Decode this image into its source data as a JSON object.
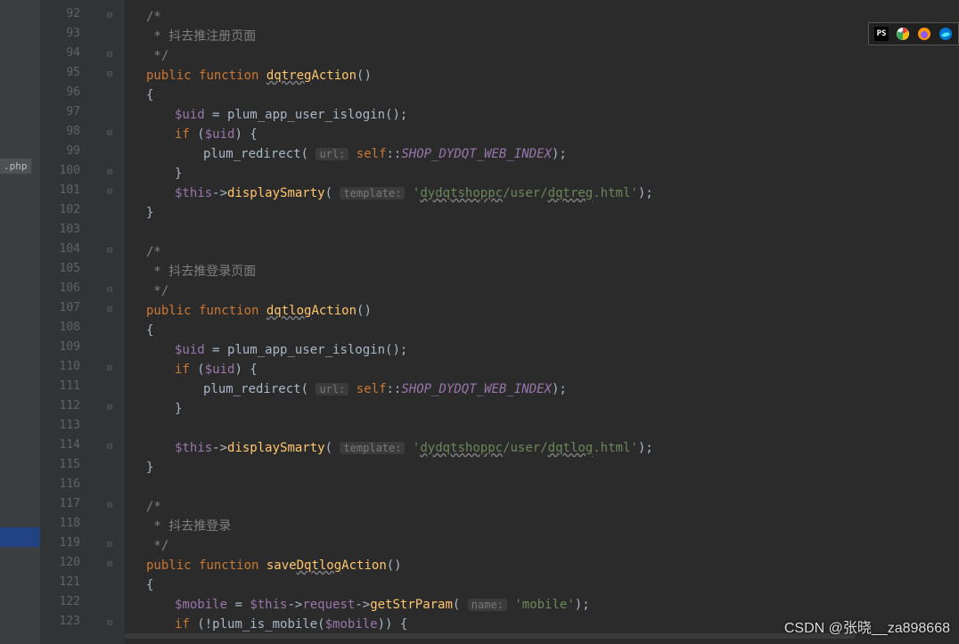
{
  "file": ".php",
  "watermark": "CSDN @张晓__za898668",
  "lines": [
    {
      "n": 92,
      "indent": 24,
      "tokens": [
        {
          "t": "/*",
          "c": "cmt"
        }
      ]
    },
    {
      "n": 93,
      "indent": 24,
      "tokens": [
        {
          "t": " * 抖去推注册页面",
          "c": "cmt"
        }
      ]
    },
    {
      "n": 94,
      "indent": 24,
      "tokens": [
        {
          "t": " */",
          "c": "cmt"
        }
      ]
    },
    {
      "n": 95,
      "indent": 24,
      "tokens": [
        {
          "t": "public ",
          "c": "kw"
        },
        {
          "t": "function ",
          "c": "kw"
        },
        {
          "t": "dqtreg",
          "c": "fn wavy"
        },
        {
          "t": "Action",
          "c": "fn"
        },
        {
          "t": "()",
          "c": "op"
        }
      ]
    },
    {
      "n": 96,
      "indent": 24,
      "tokens": [
        {
          "t": "{",
          "c": "op"
        }
      ]
    },
    {
      "n": 97,
      "indent": 56,
      "tokens": [
        {
          "t": "$uid",
          "c": "var"
        },
        {
          "t": " = ",
          "c": "op"
        },
        {
          "t": "plum_app_user_islogin",
          "c": "dot"
        },
        {
          "t": "();",
          "c": "op"
        }
      ]
    },
    {
      "n": 98,
      "indent": 56,
      "tokens": [
        {
          "t": "if ",
          "c": "kw"
        },
        {
          "t": "(",
          "c": "op"
        },
        {
          "t": "$uid",
          "c": "var"
        },
        {
          "t": ") {",
          "c": "op"
        }
      ]
    },
    {
      "n": 99,
      "indent": 88,
      "tokens": [
        {
          "t": "plum_redirect",
          "c": "dot"
        },
        {
          "t": "( ",
          "c": "op"
        },
        {
          "t": "url:",
          "c": "hint"
        },
        {
          "t": " ",
          "c": "op"
        },
        {
          "t": "self",
          "c": "kw"
        },
        {
          "t": "::",
          "c": "op"
        },
        {
          "t": "SHOP_DYDQT_WEB_INDEX",
          "c": "const"
        },
        {
          "t": ");",
          "c": "op"
        }
      ]
    },
    {
      "n": 100,
      "indent": 56,
      "tokens": [
        {
          "t": "}",
          "c": "op"
        }
      ]
    },
    {
      "n": 101,
      "indent": 56,
      "tokens": [
        {
          "t": "$this",
          "c": "var"
        },
        {
          "t": "->",
          "c": "op"
        },
        {
          "t": "displaySmarty",
          "c": "fn"
        },
        {
          "t": "( ",
          "c": "op"
        },
        {
          "t": "template:",
          "c": "hint"
        },
        {
          "t": " ",
          "c": "op"
        },
        {
          "t": "'",
          "c": "str"
        },
        {
          "t": "dydqtshoppc",
          "c": "str wavy"
        },
        {
          "t": "/user/",
          "c": "str"
        },
        {
          "t": "dqtreg",
          "c": "str wavy"
        },
        {
          "t": ".html'",
          "c": "str"
        },
        {
          "t": ");",
          "c": "op"
        }
      ]
    },
    {
      "n": 102,
      "indent": 24,
      "tokens": [
        {
          "t": "}",
          "c": "op"
        }
      ]
    },
    {
      "n": 103,
      "indent": 24,
      "tokens": []
    },
    {
      "n": 104,
      "indent": 24,
      "tokens": [
        {
          "t": "/*",
          "c": "cmt"
        }
      ]
    },
    {
      "n": 105,
      "indent": 24,
      "tokens": [
        {
          "t": " * 抖去推登录页面",
          "c": "cmt"
        }
      ]
    },
    {
      "n": 106,
      "indent": 24,
      "tokens": [
        {
          "t": " */",
          "c": "cmt"
        }
      ]
    },
    {
      "n": 107,
      "indent": 24,
      "tokens": [
        {
          "t": "public ",
          "c": "kw"
        },
        {
          "t": "function ",
          "c": "kw"
        },
        {
          "t": "dqtlog",
          "c": "fn wavy"
        },
        {
          "t": "Action",
          "c": "fn"
        },
        {
          "t": "()",
          "c": "op"
        }
      ]
    },
    {
      "n": 108,
      "indent": 24,
      "tokens": [
        {
          "t": "{",
          "c": "op"
        }
      ]
    },
    {
      "n": 109,
      "indent": 56,
      "tokens": [
        {
          "t": "$uid",
          "c": "var"
        },
        {
          "t": " = ",
          "c": "op"
        },
        {
          "t": "plum_app_user_islogin",
          "c": "dot"
        },
        {
          "t": "();",
          "c": "op"
        }
      ]
    },
    {
      "n": 110,
      "indent": 56,
      "tokens": [
        {
          "t": "if ",
          "c": "kw"
        },
        {
          "t": "(",
          "c": "op"
        },
        {
          "t": "$uid",
          "c": "var"
        },
        {
          "t": ") {",
          "c": "op"
        }
      ]
    },
    {
      "n": 111,
      "indent": 88,
      "tokens": [
        {
          "t": "plum_redirect",
          "c": "dot"
        },
        {
          "t": "( ",
          "c": "op"
        },
        {
          "t": "url:",
          "c": "hint"
        },
        {
          "t": " ",
          "c": "op"
        },
        {
          "t": "self",
          "c": "kw"
        },
        {
          "t": "::",
          "c": "op"
        },
        {
          "t": "SHOP_DYDQT_WEB_INDEX",
          "c": "const"
        },
        {
          "t": ");",
          "c": "op"
        }
      ]
    },
    {
      "n": 112,
      "indent": 56,
      "tokens": [
        {
          "t": "}",
          "c": "op"
        }
      ]
    },
    {
      "n": 113,
      "indent": 56,
      "tokens": []
    },
    {
      "n": 114,
      "indent": 56,
      "tokens": [
        {
          "t": "$this",
          "c": "var"
        },
        {
          "t": "->",
          "c": "op"
        },
        {
          "t": "displaySmarty",
          "c": "fn"
        },
        {
          "t": "( ",
          "c": "op"
        },
        {
          "t": "template:",
          "c": "hint"
        },
        {
          "t": " ",
          "c": "op"
        },
        {
          "t": "'",
          "c": "str"
        },
        {
          "t": "dydqtshoppc",
          "c": "str wavy"
        },
        {
          "t": "/user/",
          "c": "str"
        },
        {
          "t": "dqtlog",
          "c": "str wavy"
        },
        {
          "t": ".html'",
          "c": "str"
        },
        {
          "t": ");",
          "c": "op"
        }
      ]
    },
    {
      "n": 115,
      "indent": 24,
      "tokens": [
        {
          "t": "}",
          "c": "op"
        }
      ]
    },
    {
      "n": 116,
      "indent": 24,
      "tokens": []
    },
    {
      "n": 117,
      "indent": 24,
      "tokens": [
        {
          "t": "/*",
          "c": "cmt"
        }
      ]
    },
    {
      "n": 118,
      "indent": 24,
      "tokens": [
        {
          "t": " * 抖去推登录",
          "c": "cmt"
        }
      ]
    },
    {
      "n": 119,
      "indent": 24,
      "tokens": [
        {
          "t": " */",
          "c": "cmt"
        }
      ]
    },
    {
      "n": 120,
      "indent": 24,
      "tokens": [
        {
          "t": "public ",
          "c": "kw"
        },
        {
          "t": "function ",
          "c": "kw"
        },
        {
          "t": "save",
          "c": "fn"
        },
        {
          "t": "Dqtlog",
          "c": "fn wavy"
        },
        {
          "t": "Action",
          "c": "fn"
        },
        {
          "t": "()",
          "c": "op"
        }
      ]
    },
    {
      "n": 121,
      "indent": 24,
      "tokens": [
        {
          "t": "{",
          "c": "op"
        }
      ]
    },
    {
      "n": 122,
      "indent": 56,
      "tokens": [
        {
          "t": "$mobile",
          "c": "var"
        },
        {
          "t": " = ",
          "c": "op"
        },
        {
          "t": "$this",
          "c": "var"
        },
        {
          "t": "->",
          "c": "op"
        },
        {
          "t": "request",
          "c": "var"
        },
        {
          "t": "->",
          "c": "op"
        },
        {
          "t": "getStrParam",
          "c": "fn"
        },
        {
          "t": "( ",
          "c": "op"
        },
        {
          "t": "name:",
          "c": "hint"
        },
        {
          "t": " ",
          "c": "op"
        },
        {
          "t": "'mobile'",
          "c": "str"
        },
        {
          "t": ");",
          "c": "op"
        }
      ]
    },
    {
      "n": 123,
      "indent": 56,
      "tokens": [
        {
          "t": "if ",
          "c": "kw"
        },
        {
          "t": "(!",
          "c": "op"
        },
        {
          "t": "plum_is_mobile",
          "c": "dot"
        },
        {
          "t": "(",
          "c": "op"
        },
        {
          "t": "$mobile",
          "c": "var"
        },
        {
          "t": ")) {",
          "c": "op"
        }
      ]
    }
  ],
  "foldMarks": [
    92,
    94,
    95,
    98,
    100,
    101,
    104,
    106,
    107,
    110,
    112,
    114,
    117,
    119,
    120,
    123
  ],
  "icons": {
    "phpstorm": "PS",
    "chrome": "chrome",
    "firefox": "firefox",
    "edge": "edge"
  }
}
